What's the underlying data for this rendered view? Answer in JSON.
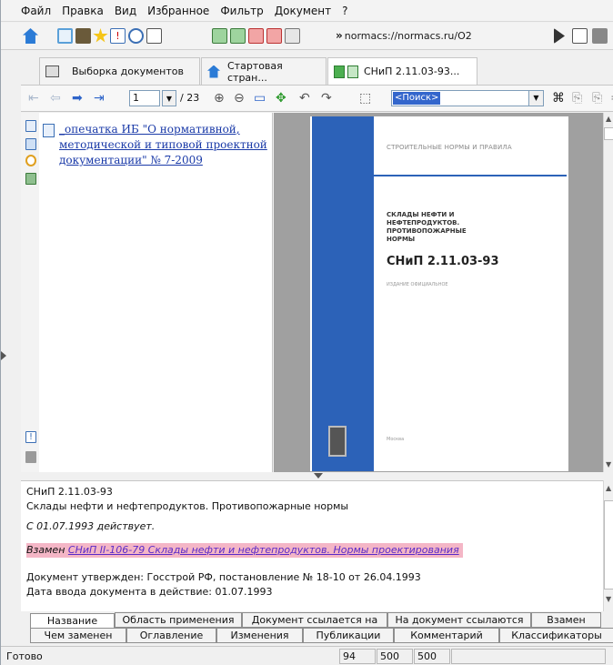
{
  "menu": [
    "Файл",
    "Правка",
    "Вид",
    "Избранное",
    "Фильтр",
    "Документ",
    "?"
  ],
  "address": {
    "prefix": "»",
    "url": "normacs://normacs.ru/O2"
  },
  "tabs": [
    {
      "label": "Выборка документов"
    },
    {
      "label": "Стартовая стран..."
    },
    {
      "label": "СНиП 2.11.03-93..."
    }
  ],
  "nav": {
    "page": "1",
    "total": "/ 23",
    "search_value": "<Поиск>"
  },
  "left_pane": {
    "link": "_опечатка ИБ \"О нормативной, методической и типовой проектной документации\" № 7-2009"
  },
  "doc_cover": {
    "header": "СТРОИТЕЛЬНЫЕ НОРМЫ И ПРАВИЛА",
    "title": "СКЛАДЫ НЕФТИ И НЕФТЕПРОДУКТОВ. ПРОТИВОПОЖАРНЫЕ НОРМЫ",
    "code": "СНиП 2.11.03-93",
    "edition": "ИЗДАНИЕ ОФИЦИАЛЬНОЕ",
    "city": "Москва"
  },
  "info": {
    "code": "СНиП 2.11.03-93",
    "name": "Склады нефти и нефтепродуктов. Противопожарные нормы",
    "status": "С 01.07.1993 действует.",
    "replaces_prefix": "Взамен",
    "replaces_link": "СНиП II-106-79 Склады нефти и нефтепродуктов. Нормы проектирования",
    "approved": "Документ утвержден: Госстрой РФ, постановление № 18-10 от 26.04.1993",
    "effective": "Дата ввода документа в действие: 01.07.1993"
  },
  "bottom_tabs_row1": [
    "Название",
    "Область применения",
    "Документ ссылается на",
    "На документ ссылаются",
    "Взамен"
  ],
  "bottom_tabs_row2": [
    "Чем заменен",
    "Оглавление",
    "Изменения",
    "Публикации",
    "Комментарий",
    "Классификаторы"
  ],
  "status": {
    "text": "Готово",
    "c1": "94",
    "c2": "500",
    "c3": "500"
  },
  "colors": {
    "accent": "#2c62b8",
    "link": "#1a3aa8",
    "highlight": "#f4b6c6",
    "search_selection": "#3366cc"
  }
}
